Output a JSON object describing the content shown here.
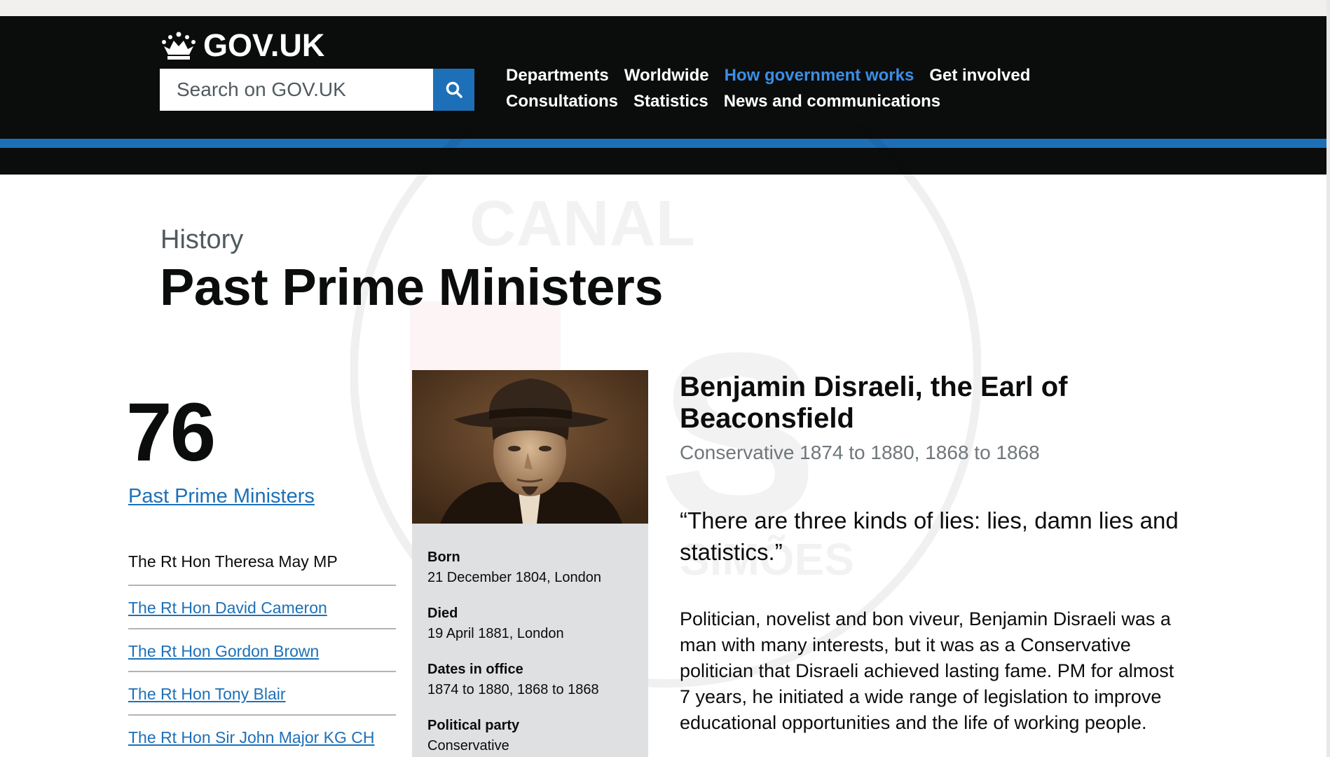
{
  "header": {
    "logo_text": "GOV.UK",
    "search_placeholder": "Search on GOV.UK",
    "nav_row1": [
      "Departments",
      "Worldwide",
      "How government works",
      "Get involved"
    ],
    "nav_row2": [
      "Consultations",
      "Statistics",
      "News and communications"
    ],
    "active_nav": "How government works",
    "brand_color": "#1d70b8"
  },
  "page": {
    "caption": "History",
    "title": "Past Prime Ministers"
  },
  "sidebar": {
    "count": "76",
    "count_link": "Past Prime Ministers",
    "items": [
      {
        "label": "The Rt Hon Theresa May MP",
        "is_link": false
      },
      {
        "label": "The Rt Hon David Cameron",
        "is_link": true
      },
      {
        "label": "The Rt Hon Gordon Brown",
        "is_link": true
      },
      {
        "label": "The Rt Hon Tony Blair",
        "is_link": true
      },
      {
        "label": "The Rt Hon Sir John Major KG CH",
        "is_link": true
      }
    ]
  },
  "profile": {
    "facts": [
      {
        "label": "Born",
        "value": "21 December 1804, London"
      },
      {
        "label": "Died",
        "value": "19 April 1881, London"
      },
      {
        "label": "Dates in office",
        "value": "1874 to 1880, 1868 to 1868"
      },
      {
        "label": "Political party",
        "value": "Conservative"
      }
    ],
    "name": "Benjamin Disraeli, the Earl of Beaconsfield",
    "term": "Conservative 1874 to 1880, 1868 to 1868",
    "quote": "“There are three kinds of lies: lies, damn lies and statistics.”",
    "bio": "Politician, novelist and bon viveur, Benjamin Disraeli was a man with many interests, but it was as a Conservative politician that Disraeli achieved lasting fame. PM for almost 7 years, he initiated a wide range of legislation to improve educational opportunities and the life of working people."
  },
  "watermark_text": [
    "CANAL",
    "SIMÕES"
  ]
}
